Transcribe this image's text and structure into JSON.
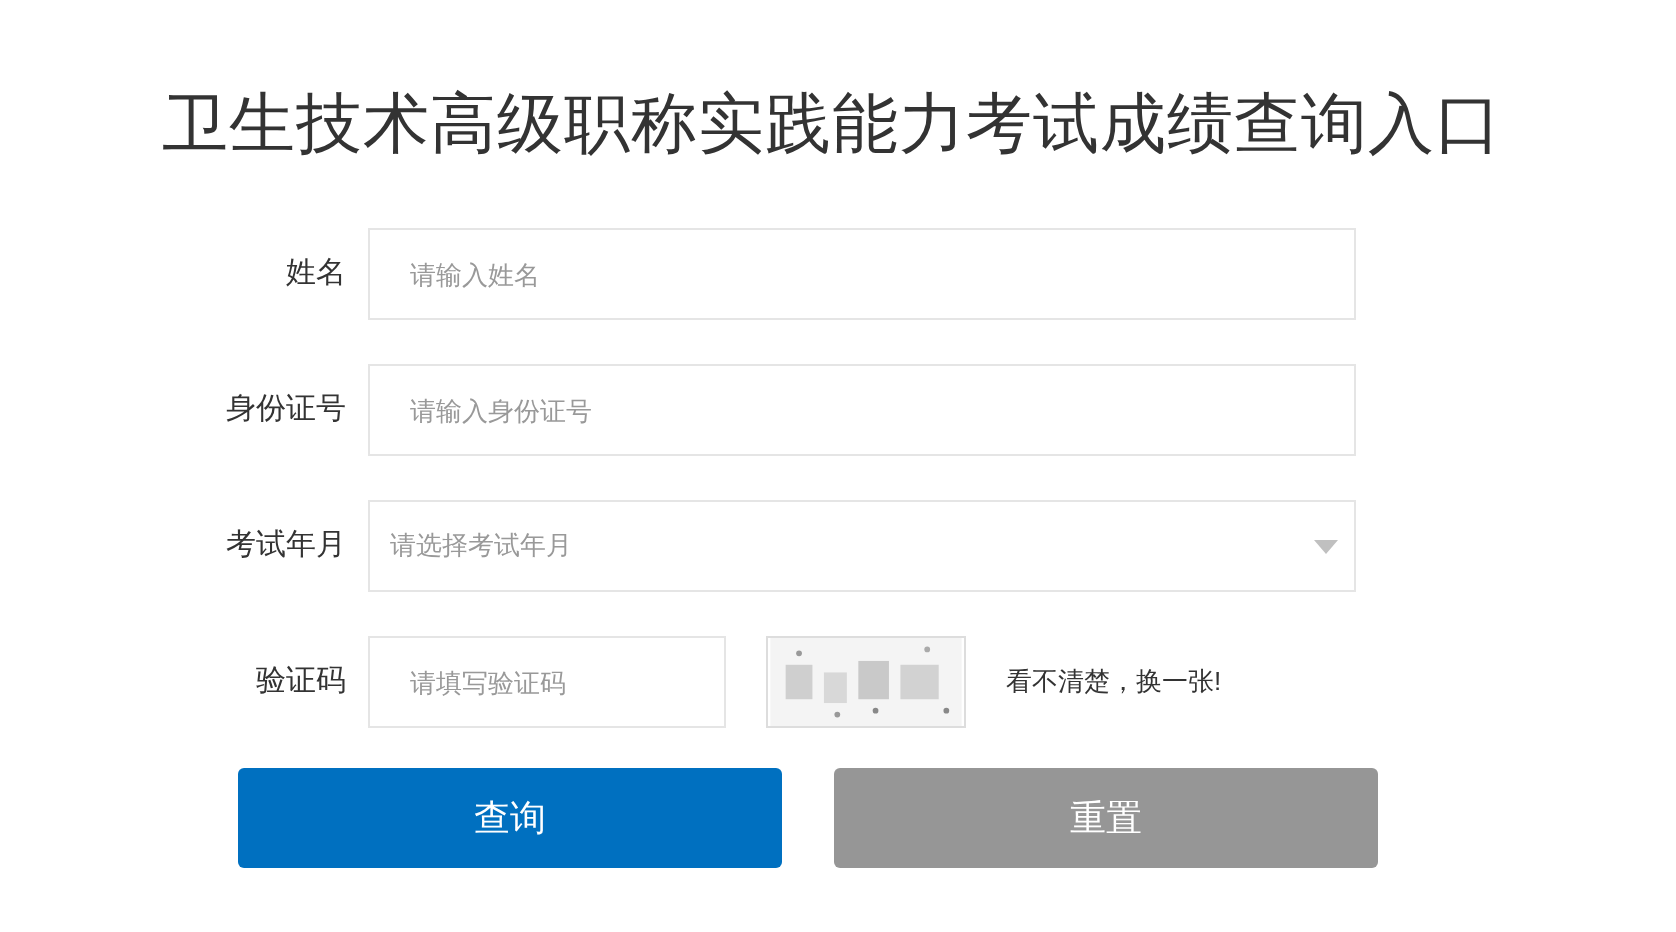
{
  "title": "卫生技术高级职称实践能力考试成绩查询入口",
  "fields": [
    {
      "kind": "text",
      "label": "姓名",
      "placeholder": "请输入姓名"
    },
    {
      "kind": "text",
      "label": "身份证号",
      "placeholder": "请输入身份证号"
    },
    {
      "kind": "select",
      "label": "考试年月",
      "placeholder": "请选择考试年月"
    },
    {
      "kind": "captcha",
      "label": "验证码",
      "placeholder": "请填写验证码",
      "refresh_link": "看不清楚，换一张!"
    }
  ],
  "buttons": [
    {
      "label": "查询",
      "disabled": false
    },
    {
      "label": "重置",
      "disabled": true
    }
  ]
}
